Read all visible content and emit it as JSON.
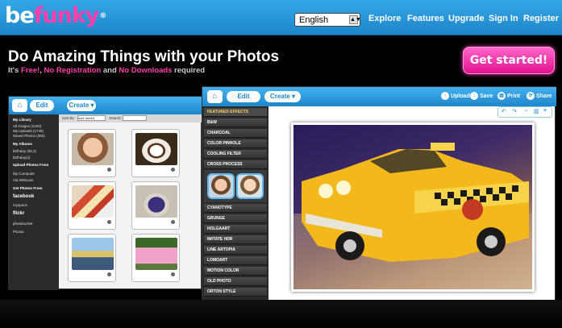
{
  "header": {
    "logo": "befunky",
    "language": "English",
    "nav": [
      "Explore",
      "Features",
      "Upgrade",
      "Sign In",
      "Register"
    ]
  },
  "hero": {
    "title": "Do Amazing Things with your Photos",
    "sub_prefix": "It's ",
    "free": "Free!",
    "sep1": ", ",
    "no_registration": "No Registration",
    "sep2": " and ",
    "no_downloads": "No Downloads",
    "sub_suffix": " required",
    "cta": "Get started!"
  },
  "library_window": {
    "edit": "Edit",
    "create": "Create ▾",
    "sort_by": "Sort By",
    "sort_value": "date added",
    "search": "Search:",
    "sidebar": {
      "my_library": "My Library",
      "all_images": "All Images (2100)",
      "my_uploads": "My Uploads (1745)",
      "saved_photos": "Saved Photos (355)",
      "my_albums": "My Albums",
      "album1": "birthday (95,2)",
      "album2": "birthday(4)",
      "upload_from": "Upload Photos From",
      "my_computer": "My Computer",
      "web_cam": "Via Webcam",
      "get_from": "Get Photos From",
      "facebook": "facebook",
      "myspace": "myspace",
      "flickr": "flickr",
      "photobucket": "photobucket",
      "picasa": "Picasa"
    }
  },
  "editor_window": {
    "edit": "Edit",
    "create": "Create ▾",
    "actions": {
      "upload": "Upload",
      "save": "Save",
      "print": "Print",
      "share": "Share"
    },
    "menu": [
      "FEATURED EFFECTS",
      "B&W",
      "CHARCOAL",
      "COLOR PINHOLE",
      "COOLING FILTER",
      "CROSS PROCESS",
      "CYANOTYPE",
      "GRUNGE",
      "HOLGAART",
      "IMITATE HDR",
      "LINE ARTOPIA",
      "LOMOART",
      "MOTION COLOR",
      "OLD PHOTO",
      "ORTON STYLE"
    ]
  }
}
